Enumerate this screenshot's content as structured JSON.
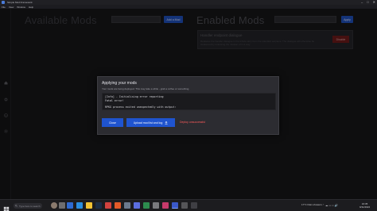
{
  "window": {
    "title": "Simple Mod Framework"
  },
  "menu": [
    "File",
    "View",
    "Window",
    "Help"
  ],
  "available": {
    "title": "Available Mods",
    "add_button": "Add a Mod"
  },
  "enabled": {
    "title": "Enabled Mods",
    "apply_button": "Apply",
    "mod": {
      "name": "Handler endpoint dialogue",
      "description": "Replaces the handler dialogue in the whole story from the standard earpiece. The dialogue will otherwise be awakened by unlocking the mission of in a way.",
      "disable_button": "Disable"
    }
  },
  "modal": {
    "title": "Applying your mods",
    "subtitle": "Your mods are being deployed. This may take a while - grab a coffee or something.",
    "console_lines": [
      "[Info] - Initialising error reporting",
      "Fatal error!",
      "",
      "RPKG process exited unexpectedly with output:"
    ],
    "close_button": "Close",
    "upload_button": "Upload mod list and log",
    "deploy_link": "Deploy unsuccessful"
  },
  "taskbar": {
    "search_placeholder": "Type here to search",
    "weather": "17°C Rain showers",
    "time": "16:35",
    "date": "9/11/2022"
  },
  "colors": {
    "accent": "#1f54cf",
    "danger": "#ff5b5b",
    "background": "#161618"
  }
}
